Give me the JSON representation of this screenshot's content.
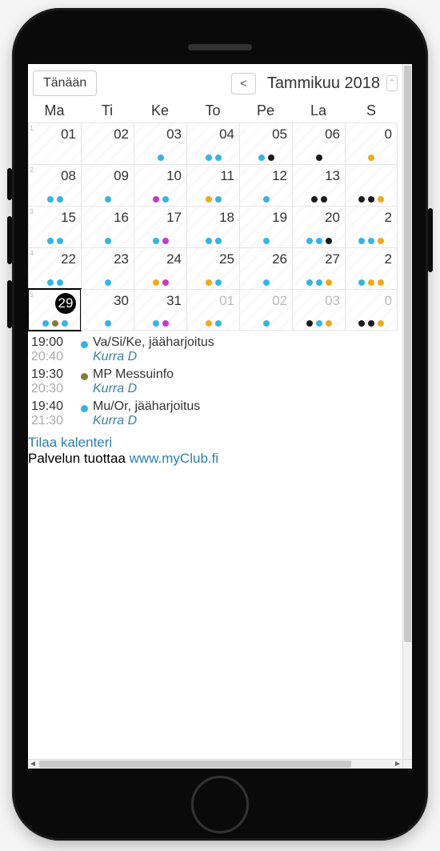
{
  "header": {
    "today_label": "Tänään",
    "prev_label": "<",
    "month_label": "Tammikuu 2018",
    "caret_label": "ˆ"
  },
  "dow": [
    "Ma",
    "Ti",
    "Ke",
    "To",
    "Pe",
    "La",
    "S"
  ],
  "weeks": [
    {
      "wk": "1",
      "days": [
        {
          "n": "01",
          "dots": []
        },
        {
          "n": "02",
          "dots": []
        },
        {
          "n": "03",
          "dots": [
            "blue"
          ]
        },
        {
          "n": "04",
          "dots": [
            "blue",
            "blue"
          ]
        },
        {
          "n": "05",
          "dots": [
            "blue",
            "black"
          ]
        },
        {
          "n": "06",
          "dots": [
            "black"
          ]
        },
        {
          "n": "0",
          "dots": [
            "orange"
          ]
        }
      ]
    },
    {
      "wk": "2",
      "days": [
        {
          "n": "08",
          "dots": [
            "blue",
            "blue"
          ]
        },
        {
          "n": "09",
          "dots": [
            "blue"
          ]
        },
        {
          "n": "10",
          "dots": [
            "magenta",
            "blue"
          ]
        },
        {
          "n": "11",
          "dots": [
            "orange",
            "blue"
          ]
        },
        {
          "n": "12",
          "dots": [
            "blue"
          ]
        },
        {
          "n": "13",
          "dots": [
            "black",
            "black"
          ]
        },
        {
          "n": "",
          "dots": [
            "black",
            "black",
            "orange"
          ]
        }
      ]
    },
    {
      "wk": "3",
      "days": [
        {
          "n": "15",
          "dots": [
            "blue",
            "blue"
          ]
        },
        {
          "n": "16",
          "dots": [
            "blue"
          ]
        },
        {
          "n": "17",
          "dots": [
            "blue",
            "magenta"
          ]
        },
        {
          "n": "18",
          "dots": [
            "blue",
            "blue"
          ]
        },
        {
          "n": "19",
          "dots": [
            "blue"
          ]
        },
        {
          "n": "20",
          "dots": [
            "blue",
            "blue",
            "black"
          ]
        },
        {
          "n": "2",
          "dots": [
            "blue",
            "blue",
            "orange"
          ]
        }
      ]
    },
    {
      "wk": "4",
      "days": [
        {
          "n": "22",
          "dots": [
            "blue",
            "blue"
          ]
        },
        {
          "n": "23",
          "dots": [
            "blue"
          ]
        },
        {
          "n": "24",
          "dots": [
            "orange",
            "magenta"
          ]
        },
        {
          "n": "25",
          "dots": [
            "orange",
            "blue"
          ]
        },
        {
          "n": "26",
          "dots": [
            "blue"
          ]
        },
        {
          "n": "27",
          "dots": [
            "blue",
            "blue",
            "orange"
          ]
        },
        {
          "n": "2",
          "dots": [
            "blue",
            "orange",
            "orange"
          ]
        }
      ]
    },
    {
      "wk": "5",
      "days": [
        {
          "n": "29",
          "dots": [
            "blue",
            "olive",
            "blue"
          ],
          "selected": true
        },
        {
          "n": "30",
          "dots": [
            "blue"
          ]
        },
        {
          "n": "31",
          "dots": [
            "blue",
            "magenta"
          ]
        },
        {
          "n": "01",
          "dots": [
            "orange",
            "blue"
          ],
          "muted": true
        },
        {
          "n": "02",
          "dots": [
            "blue"
          ],
          "muted": true
        },
        {
          "n": "03",
          "dots": [
            "black",
            "blue",
            "orange"
          ],
          "muted": true
        },
        {
          "n": "0",
          "dots": [
            "black",
            "black",
            "orange"
          ],
          "muted": true
        }
      ]
    }
  ],
  "events": [
    {
      "start": "19:00",
      "end": "20:40",
      "color": "blue",
      "title": "Va/Si/Ke, jääharjoitus",
      "sub": "Kurra D"
    },
    {
      "start": "19:30",
      "end": "20:30",
      "color": "olive",
      "title": "MP Messuinfo",
      "sub": "Kurra D"
    },
    {
      "start": "19:40",
      "end": "21:30",
      "color": "blue",
      "title": "Mu/Or, jääharjoitus",
      "sub": "Kurra D"
    }
  ],
  "footer": {
    "subscribe": "Tilaa kalenteri",
    "provided_prefix": "Palvelun tuottaa ",
    "provider_link": "www.myClub.fi"
  }
}
